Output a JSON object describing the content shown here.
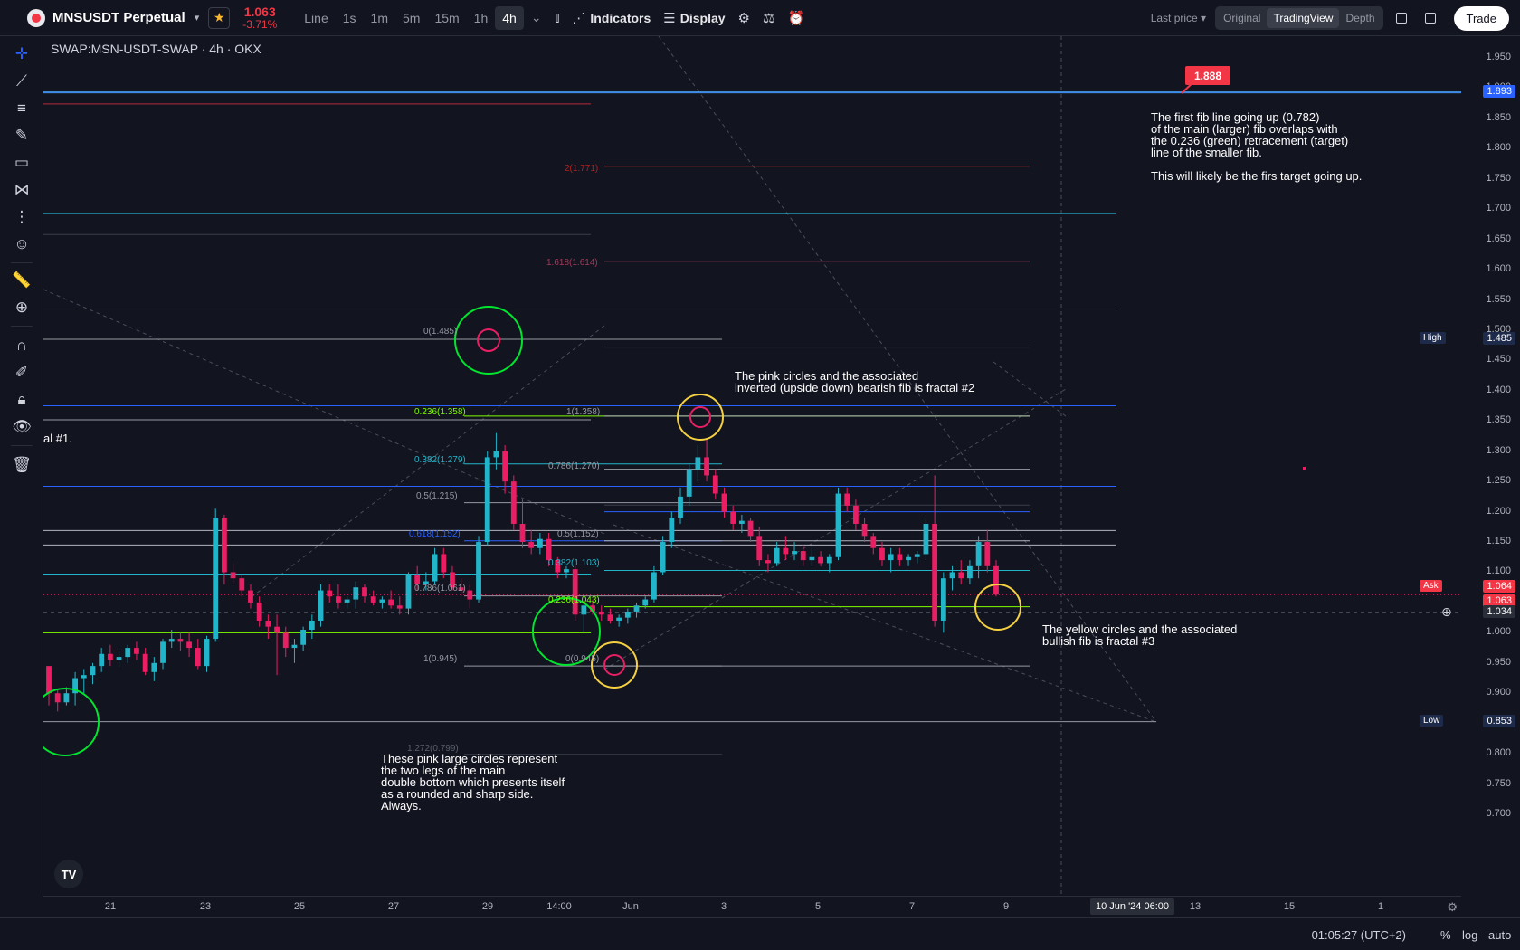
{
  "header": {
    "symbol": "MNSUSDT Perpetual",
    "last_price": "1.063",
    "change": "-3.71%",
    "timeframes": [
      "Line",
      "1s",
      "1m",
      "5m",
      "15m",
      "1h",
      "4h"
    ],
    "active_timeframe": "4h",
    "indicators_label": "Indicators",
    "display_label": "Display",
    "price_select": "Last price",
    "views": [
      "Original",
      "TradingView",
      "Depth"
    ],
    "active_view": "TradingView",
    "trade_label": "Trade"
  },
  "chart": {
    "pair_legend": "SWAP:MSN-USDT-SWAP · 4h · OKX",
    "partial_label": "al #1.",
    "annotations": {
      "fractal2": "The pink circles and the associated\ninverted (upside down) bearish fib is fractal #2",
      "fractal3": "The yellow circles and the associated\nbullish fib is fractal #3",
      "main_fib": "The first fib line going up (0.782)\nof the main (larger) fib overlaps with\nthe 0.236 (green) retracement (target)\nline of the smaller fib.\n\nThis will likely be the firs target going up.",
      "double_bottom": "These pink large circles represent\nthe two legs of the main\ndouble bottom which presents itself\nas a rounded and sharp side.\nAlways."
    },
    "target_badge": "1.888",
    "fib_labels": {
      "l2": "2(1.771)",
      "l1618": "1.618(1.614)",
      "l0a": "0(1.485)",
      "l0236": "0.236(1.358)",
      "l1b": "1(1.358)",
      "l0382": "0.382(1.279)",
      "l0786b": "0.786(1.270)",
      "l05a": "0.5(1.215)",
      "l0618a": "0.618(1.152)",
      "l05b": "0.5(1.152)",
      "l0382b": "0.382(1.103)",
      "l0786a": "0.786(1.061)",
      "l0236b": "0.236(1.043)",
      "l1a": "1(0.945)",
      "l0b": "0(0.945)",
      "l1272": "1.272(0.799)"
    }
  },
  "price_axis": {
    "ticks": [
      "1.950",
      "1.900",
      "1.850",
      "1.800",
      "1.750",
      "1.700",
      "1.650",
      "1.600",
      "1.550",
      "1.500",
      "1.450",
      "1.400",
      "1.350",
      "1.300",
      "1.250",
      "1.200",
      "1.150",
      "1.100",
      "1.050",
      "1.000",
      "0.950",
      "0.900",
      "0.850",
      "0.800",
      "0.750",
      "0.700"
    ],
    "badge_current_line": "1.893",
    "high_label": "High",
    "high_value": "1.485",
    "ask_label": "Ask",
    "ask_value": "1.064",
    "last_value": "1.063",
    "crosshair_value": "1.034",
    "low_label": "Low",
    "low_value": "0.853"
  },
  "time_axis": {
    "ticks": [
      "21",
      "23",
      "25",
      "27",
      "29",
      "14:00",
      "Jun",
      "3",
      "5",
      "7",
      "9",
      "13",
      "15",
      "1"
    ],
    "crosshair_date": "10 Jun '24  06:00"
  },
  "bottombar": {
    "clock": "01:05:27 (UTC+2)",
    "percent": "%",
    "log": "log",
    "auto": "auto"
  },
  "colors": {
    "background": "#121420",
    "up": "#22b5c9",
    "down": "#e91e63",
    "fib_green": "#7fff00",
    "fib_blue": "#2962ff",
    "circle_green": "#00e62e",
    "circle_pink": "#e91e63",
    "circle_yellow": "#f5d142"
  },
  "chart_data": {
    "type": "candlestick",
    "note": "OHLC of MSN-USDT-SWAP 4h, values approximated from the price axis",
    "candles": [
      [
        0.945,
        0.935,
        0.88,
        0.9
      ],
      [
        0.9,
        0.905,
        0.87,
        0.885
      ],
      [
        0.885,
        0.91,
        0.88,
        0.9
      ],
      [
        0.9,
        0.935,
        0.88,
        0.925
      ],
      [
        0.925,
        0.94,
        0.9,
        0.93
      ],
      [
        0.93,
        0.95,
        0.915,
        0.945
      ],
      [
        0.945,
        0.975,
        0.935,
        0.965
      ],
      [
        0.965,
        0.98,
        0.945,
        0.955
      ],
      [
        0.955,
        0.97,
        0.945,
        0.96
      ],
      [
        0.96,
        0.98,
        0.95,
        0.975
      ],
      [
        0.975,
        0.985,
        0.955,
        0.965
      ],
      [
        0.965,
        0.975,
        0.93,
        0.935
      ],
      [
        0.935,
        0.96,
        0.92,
        0.95
      ],
      [
        0.95,
        0.99,
        0.94,
        0.985
      ],
      [
        0.985,
        1.005,
        0.975,
        0.99
      ],
      [
        0.99,
        1.0,
        0.97,
        0.985
      ],
      [
        0.985,
        1.0,
        0.96,
        0.975
      ],
      [
        0.975,
        0.99,
        0.94,
        0.945
      ],
      [
        0.945,
        0.995,
        0.935,
        0.99
      ],
      [
        0.99,
        1.205,
        0.985,
        1.19
      ],
      [
        1.19,
        1.195,
        1.08,
        1.1
      ],
      [
        1.1,
        1.115,
        1.08,
        1.09
      ],
      [
        1.09,
        1.095,
        1.06,
        1.07
      ],
      [
        1.07,
        1.08,
        1.04,
        1.05
      ],
      [
        1.05,
        1.06,
        1.01,
        1.02
      ],
      [
        1.02,
        1.03,
        0.99,
        1.01
      ],
      [
        1.01,
        1.03,
        0.93,
        1.0
      ],
      [
        1.0,
        1.01,
        0.96,
        0.975
      ],
      [
        0.975,
        0.99,
        0.95,
        0.98
      ],
      [
        0.98,
        1.01,
        0.97,
        1.005
      ],
      [
        1.005,
        1.03,
        0.99,
        1.02
      ],
      [
        1.02,
        1.08,
        1.01,
        1.07
      ],
      [
        1.07,
        1.08,
        1.05,
        1.06
      ],
      [
        1.06,
        1.08,
        1.04,
        1.05
      ],
      [
        1.05,
        1.06,
        1.04,
        1.055
      ],
      [
        1.055,
        1.085,
        1.04,
        1.075
      ],
      [
        1.075,
        1.08,
        1.05,
        1.06
      ],
      [
        1.06,
        1.07,
        1.045,
        1.05
      ],
      [
        1.05,
        1.06,
        1.04,
        1.055
      ],
      [
        1.055,
        1.07,
        1.04,
        1.045
      ],
      [
        1.045,
        1.06,
        1.03,
        1.04
      ],
      [
        1.04,
        1.1,
        1.03,
        1.095
      ],
      [
        1.095,
        1.11,
        1.07,
        1.08
      ],
      [
        1.08,
        1.1,
        1.07,
        1.085
      ],
      [
        1.085,
        1.14,
        1.08,
        1.13
      ],
      [
        1.13,
        1.14,
        1.09,
        1.1
      ],
      [
        1.1,
        1.11,
        1.07,
        1.075
      ],
      [
        1.075,
        1.09,
        1.06,
        1.07
      ],
      [
        1.07,
        1.08,
        1.04,
        1.055
      ],
      [
        1.055,
        1.16,
        1.05,
        1.15
      ],
      [
        1.15,
        1.3,
        1.145,
        1.29
      ],
      [
        1.29,
        1.33,
        1.27,
        1.3
      ],
      [
        1.3,
        1.31,
        1.23,
        1.25
      ],
      [
        1.25,
        1.26,
        1.17,
        1.18
      ],
      [
        1.18,
        1.22,
        1.14,
        1.15
      ],
      [
        1.15,
        1.17,
        1.13,
        1.14
      ],
      [
        1.14,
        1.165,
        1.13,
        1.155
      ],
      [
        1.155,
        1.165,
        1.11,
        1.12
      ],
      [
        1.12,
        1.125,
        1.09,
        1.1
      ],
      [
        1.1,
        1.11,
        1.09,
        1.105
      ],
      [
        1.105,
        1.11,
        1.02,
        1.03
      ],
      [
        1.03,
        1.05,
        1.0,
        1.045
      ],
      [
        1.045,
        1.055,
        1.03,
        1.035
      ],
      [
        1.035,
        1.045,
        1.02,
        1.03
      ],
      [
        1.03,
        1.04,
        1.015,
        1.02
      ],
      [
        1.02,
        1.03,
        1.01,
        1.025
      ],
      [
        1.025,
        1.04,
        1.015,
        1.035
      ],
      [
        1.035,
        1.05,
        1.025,
        1.045
      ],
      [
        1.045,
        1.06,
        1.04,
        1.055
      ],
      [
        1.055,
        1.11,
        1.05,
        1.1
      ],
      [
        1.1,
        1.16,
        1.095,
        1.15
      ],
      [
        1.15,
        1.2,
        1.14,
        1.19
      ],
      [
        1.19,
        1.24,
        1.18,
        1.225
      ],
      [
        1.225,
        1.28,
        1.21,
        1.27
      ],
      [
        1.27,
        1.31,
        1.25,
        1.29
      ],
      [
        1.29,
        1.32,
        1.25,
        1.26
      ],
      [
        1.26,
        1.27,
        1.22,
        1.23
      ],
      [
        1.23,
        1.24,
        1.19,
        1.2
      ],
      [
        1.2,
        1.21,
        1.17,
        1.18
      ],
      [
        1.18,
        1.195,
        1.165,
        1.185
      ],
      [
        1.185,
        1.19,
        1.15,
        1.16
      ],
      [
        1.16,
        1.175,
        1.11,
        1.12
      ],
      [
        1.12,
        1.13,
        1.1,
        1.115
      ],
      [
        1.115,
        1.15,
        1.11,
        1.14
      ],
      [
        1.14,
        1.16,
        1.12,
        1.13
      ],
      [
        1.13,
        1.15,
        1.12,
        1.135
      ],
      [
        1.135,
        1.145,
        1.11,
        1.12
      ],
      [
        1.12,
        1.14,
        1.11,
        1.125
      ],
      [
        1.125,
        1.135,
        1.11,
        1.115
      ],
      [
        1.115,
        1.13,
        1.1,
        1.125
      ],
      [
        1.125,
        1.24,
        1.12,
        1.23
      ],
      [
        1.23,
        1.24,
        1.2,
        1.21
      ],
      [
        1.21,
        1.22,
        1.17,
        1.18
      ],
      [
        1.18,
        1.19,
        1.15,
        1.16
      ],
      [
        1.16,
        1.165,
        1.13,
        1.14
      ],
      [
        1.14,
        1.15,
        1.11,
        1.12
      ],
      [
        1.12,
        1.14,
        1.1,
        1.13
      ],
      [
        1.13,
        1.14,
        1.11,
        1.12
      ],
      [
        1.12,
        1.13,
        1.11,
        1.125
      ],
      [
        1.125,
        1.135,
        1.115,
        1.13
      ],
      [
        1.13,
        1.19,
        1.12,
        1.18
      ],
      [
        1.18,
        1.26,
        1.01,
        1.02
      ],
      [
        1.02,
        1.1,
        1.0,
        1.09
      ],
      [
        1.09,
        1.11,
        1.07,
        1.1
      ],
      [
        1.1,
        1.12,
        1.08,
        1.09
      ],
      [
        1.09,
        1.12,
        1.08,
        1.11
      ],
      [
        1.11,
        1.16,
        1.09,
        1.15
      ],
      [
        1.15,
        1.17,
        1.1,
        1.11
      ],
      [
        1.11,
        1.12,
        1.06,
        1.063
      ]
    ],
    "ylim": [
      0.68,
      1.98
    ]
  }
}
